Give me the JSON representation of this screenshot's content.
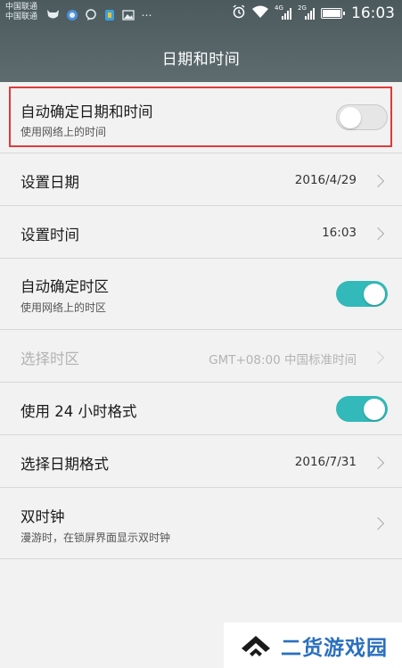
{
  "status_bar": {
    "carrier_1": "中国联通",
    "carrier_2": "中国联通",
    "network_1": "4G",
    "network_2": "2G",
    "time": "16:03"
  },
  "header": {
    "title": "日期和时间"
  },
  "settings": {
    "auto_datetime": {
      "title": "自动确定日期和时间",
      "subtitle": "使用网络上的时间",
      "enabled": false
    },
    "set_date": {
      "title": "设置日期",
      "value": "2016/4/29"
    },
    "set_time": {
      "title": "设置时间",
      "value": "16:03"
    },
    "auto_timezone": {
      "title": "自动确定时区",
      "subtitle": "使用网络上的时区",
      "enabled": true
    },
    "select_timezone": {
      "title": "选择时区",
      "value": "GMT+08:00 中国标准时间"
    },
    "use_24h": {
      "title": "使用 24 小时格式",
      "enabled": true
    },
    "date_format": {
      "title": "选择日期格式",
      "value": "2016/7/31"
    },
    "dual_clock": {
      "title": "双时钟",
      "subtitle": "漫游时，在锁屏界面显示双时钟"
    }
  },
  "watermark": {
    "text": "二货游戏园"
  },
  "colors": {
    "header_bg": "#55646a",
    "toggle_on": "#33b9b9",
    "highlight": "#e03a3a",
    "watermark": "#2a6fbf"
  }
}
